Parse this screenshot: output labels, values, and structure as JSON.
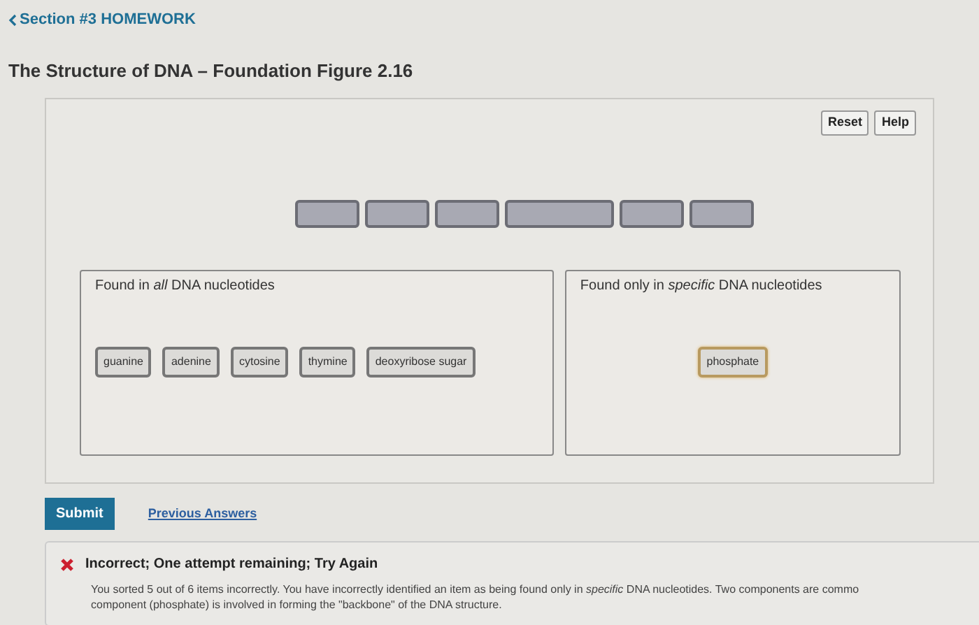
{
  "breadcrumb": "Section #3 HOMEWORK",
  "title": "The Structure of DNA – Foundation Figure 2.16",
  "tool_buttons": [
    "Reset",
    "Help"
  ],
  "slots": [
    {
      "wide": false
    },
    {
      "wide": false
    },
    {
      "wide": false
    },
    {
      "wide": true
    },
    {
      "wide": false
    },
    {
      "wide": false
    }
  ],
  "bins": [
    {
      "label": "Found in *all* DNA nucleotides",
      "tiles": [
        {
          "label": "guanine",
          "highlighted": false
        },
        {
          "label": "adenine",
          "highlighted": false
        },
        {
          "label": "cytosine",
          "highlighted": false
        },
        {
          "label": "thymine",
          "highlighted": false
        },
        {
          "label": "deoxyribose sugar",
          "highlighted": false
        }
      ]
    },
    {
      "label": "Found only in *specific* DNA nucleotides",
      "tiles": [
        {
          "label": "phosphate",
          "highlighted": true
        }
      ]
    }
  ],
  "submit": "Submit",
  "previous_answers": "Previous Answers",
  "feedback": {
    "correct": false,
    "heading": "Incorrect; One attempt remaining; Try Again",
    "lines": [
      "You sorted 5 out of 6 items incorrectly. You have incorrectly identified an item as being found only in *specific* DNA nucleotides. Two components are commo",
      "component (phosphate) is involved in forming the \"backbone\" of the DNA structure."
    ]
  }
}
